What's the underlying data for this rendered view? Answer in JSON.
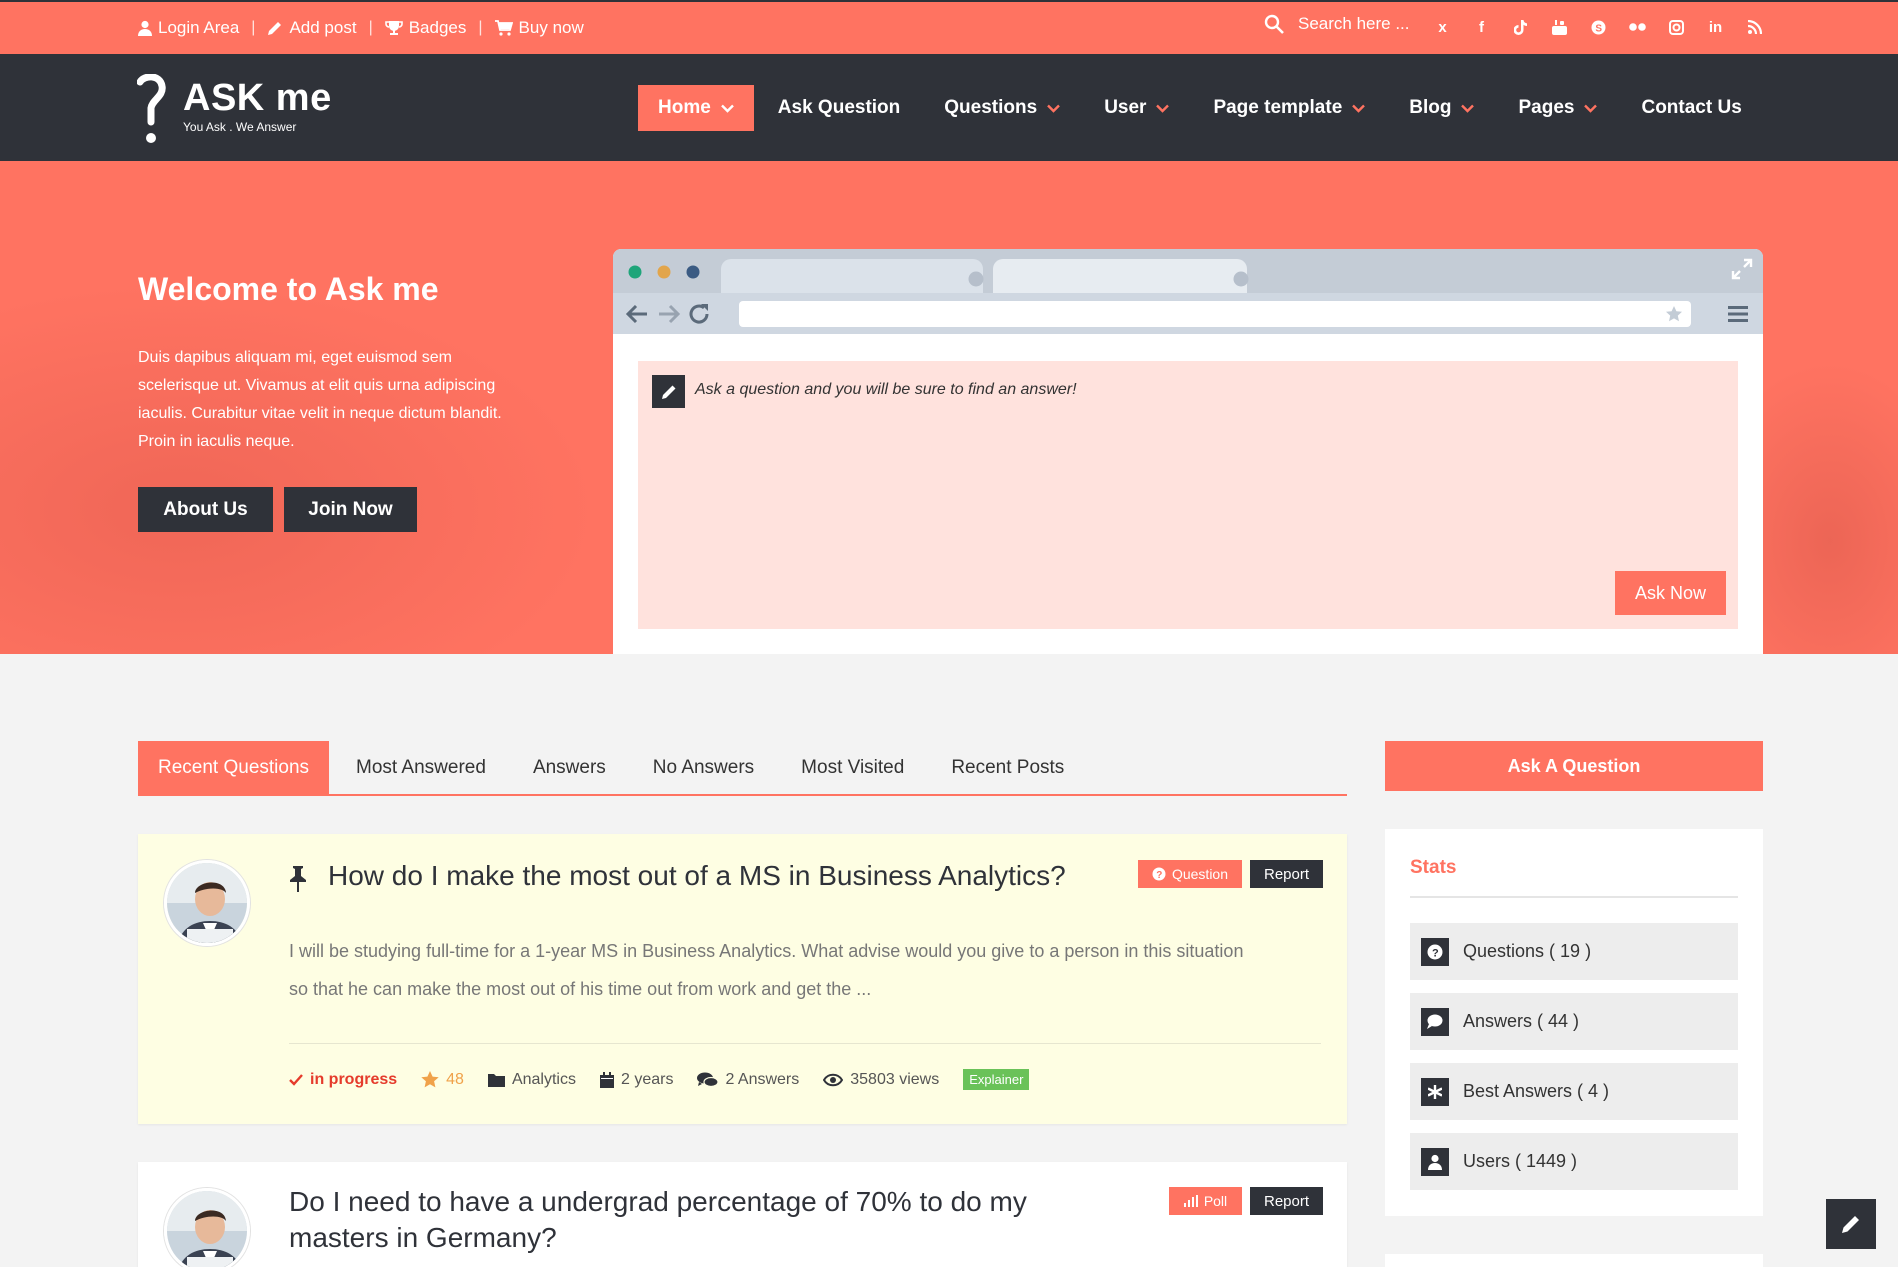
{
  "topbar": {
    "links": [
      {
        "label": "Login Area",
        "icon": "user-icon"
      },
      {
        "label": "Add post",
        "icon": "pencil-icon"
      },
      {
        "label": "Badges",
        "icon": "trophy-icon"
      },
      {
        "label": "Buy now",
        "icon": "cart-icon"
      }
    ],
    "search_placeholder": "Search here ...",
    "social": [
      "x",
      "f",
      "tiktok",
      "youtube",
      "skype",
      "flickr",
      "instagram",
      "in",
      "rss"
    ]
  },
  "logo": {
    "name": "ASK me",
    "tagline": "You Ask . We Answer"
  },
  "nav": {
    "items": [
      {
        "label": "Home",
        "dropdown": true,
        "active": true
      },
      {
        "label": "Ask Question",
        "dropdown": false
      },
      {
        "label": "Questions",
        "dropdown": true
      },
      {
        "label": "User",
        "dropdown": true
      },
      {
        "label": "Page template",
        "dropdown": true
      },
      {
        "label": "Blog",
        "dropdown": true
      },
      {
        "label": "Pages",
        "dropdown": true
      },
      {
        "label": "Contact Us",
        "dropdown": false
      }
    ]
  },
  "hero": {
    "title": "Welcome to Ask me",
    "description": "Duis dapibus aliquam mi, eget euismod sem scelerisque ut. Vivamus at elit quis urna adipiscing iaculis. Curabitur vitae velit in neque dictum blandit. Proin in iaculis neque.",
    "about_label": "About Us",
    "join_label": "Join Now",
    "ask_placeholder": "Ask a question and you will be sure to find an answer!",
    "ask_now_label": "Ask Now"
  },
  "tabs": [
    "Recent Questions",
    "Most Answered",
    "Answers",
    "No Answers",
    "Most Visited",
    "Recent Posts"
  ],
  "questions": [
    {
      "title": "How do I make the most out of a MS in Business Analytics?",
      "type_label": "Question",
      "report_label": "Report",
      "excerpt": "I will be studying full-time for a 1-year MS in Business Analytics. What advise would you give to a person in this situation so that he can make the most out of his time out from work and get the ...",
      "status": "in progress",
      "points": "48",
      "category": "Analytics",
      "age": "2 years",
      "answers": "2 Answers",
      "views": "35803 views",
      "tag": "Explainer"
    },
    {
      "title": "Do I need to have a undergrad percentage of 70% to do my masters in Germany?",
      "type_label": "Poll",
      "report_label": "Report"
    }
  ],
  "sidebar": {
    "ask_label": "Ask A Question",
    "stats_title": "Stats",
    "stats": [
      {
        "label": "Questions ( 19 )",
        "icon": "question-circle-icon"
      },
      {
        "label": "Answers ( 44 )",
        "icon": "comment-icon"
      },
      {
        "label": "Best Answers ( 4 )",
        "icon": "asterisk-icon"
      },
      {
        "label": "Users ( 1449 )",
        "icon": "user-icon"
      }
    ]
  },
  "colors": {
    "accent": "#ff7361",
    "dark": "#2f3239",
    "pinned_bg": "#fefee3",
    "tag_green": "#6ac259"
  }
}
